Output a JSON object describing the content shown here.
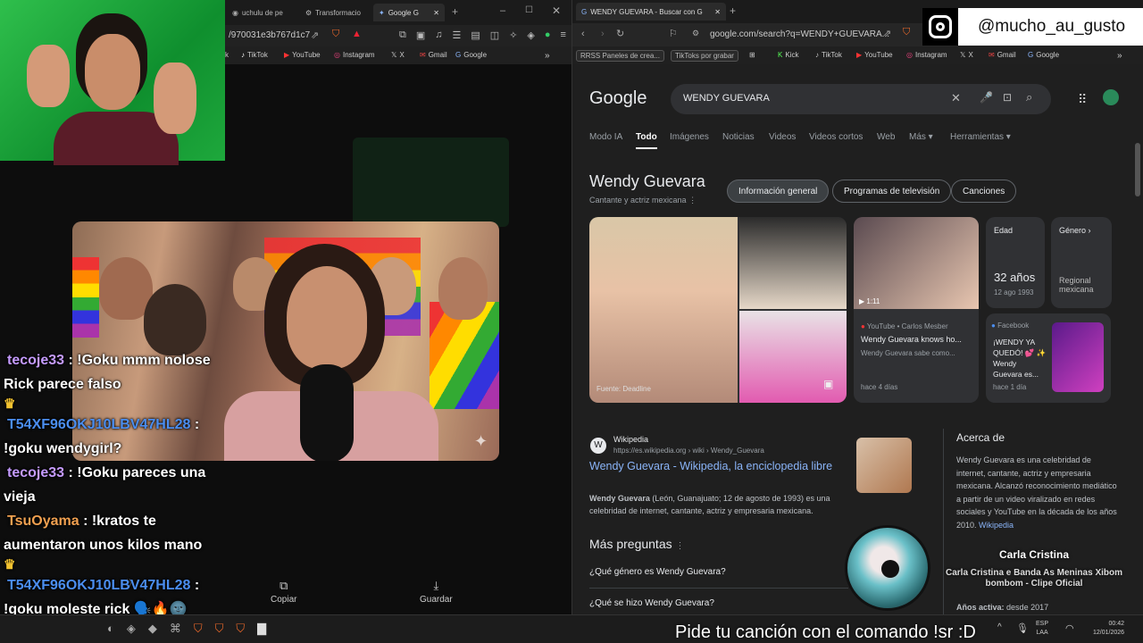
{
  "left_browser": {
    "tabs": [
      "uchulu de pe",
      "Transformacio",
      "Google G"
    ],
    "url_fragment": "/970031e3b767d1c7",
    "bookmarks": [
      "k",
      "TikTok",
      "YouTube",
      "Instagram",
      "X",
      "Gmail",
      "Google"
    ],
    "actions": {
      "copy": "Copiar",
      "save": "Guardar"
    }
  },
  "chat": {
    "messages": [
      {
        "user": "tecoje33",
        "user_color": "#c59bff",
        "text": "!Goku mmm nolose Rick parece falso",
        "badge": true
      },
      {
        "user": "T54XF96OKJ10LBV47HL28",
        "user_color": "#4b8ef0",
        "text": "!goku wendygirl?",
        "badge": false
      },
      {
        "user": "tecoje33",
        "user_color": "#c59bff",
        "text": "!Goku pareces una vieja",
        "badge": false
      },
      {
        "user": "TsuOyama",
        "user_color": "#f0a050",
        "text": "!kratos te aumentaron unos kilos mano",
        "badge": true
      },
      {
        "user": "T54XF96OKJ10LBV47HL28",
        "user_color": "#4b8ef0",
        "text": "!goku moleste rick 🗣️🔥🌚",
        "badge": false
      }
    ]
  },
  "right_browser": {
    "tab_title": "WENDY GUEVARA - Buscar con G",
    "url": "google.com/search?q=WENDY+GUEVARA...",
    "bookmarks": [
      "RRSS Paneles de crea...",
      "TikToks por grabar",
      "Kick",
      "TikTok",
      "YouTube",
      "Instagram",
      "X",
      "Gmail",
      "Google"
    ],
    "search": {
      "logo": "Google",
      "query": "WENDY GUEVARA",
      "tabs": [
        "Modo IA",
        "Todo",
        "Imágenes",
        "Noticias",
        "Videos",
        "Videos cortos",
        "Web",
        "Más",
        "Herramientas"
      ],
      "active_tab": "Todo"
    },
    "kp": {
      "title": "Wendy Guevara",
      "subtitle": "Cantante y actriz mexicana",
      "pills": [
        "Información general",
        "Programas de televisión",
        "Canciones"
      ],
      "age_label": "Edad",
      "age_value": "32 años",
      "age_date": "12 ago 1993",
      "genre_label": "Género",
      "genre_value": "Regional mexicana",
      "video_duration": "1:11",
      "video_source": "YouTube • Carlos Mesber",
      "video_title": "Wendy Guevara knows ho...",
      "video_desc": "Wendy Guevara sabe como...",
      "video_age": "hace 4 días",
      "fb_source": "Facebook",
      "fb_text": "¡WENDY YA QUEDÓ! 💕 ✨ Wendy Guevara es...",
      "fb_age": "hace 1 día",
      "img_source": "Fuente: Deadline"
    },
    "result": {
      "site": "Wikipedia",
      "url": "https://es.wikipedia.org › wiki › Wendy_Guevara",
      "title": "Wendy Guevara - Wikipedia, la enciclopedia libre",
      "snippet_bold": "Wendy Guevara",
      "snippet": " (León, Guanajuato; 12 de agosto de 1993) es una celebridad de internet, cantante, actriz y empresaria mexicana."
    },
    "about": {
      "title": "Acerca de",
      "text": "Wendy Guevara  es una celebridad de internet, cantante, actriz y empresaria mexicana. Alcanzó reconocimiento mediático a partir de un video viralizado en redes sociales y YouTube en la década de los años 2010.",
      "link": "Wikipedia",
      "active_label": "Años activa:",
      "active_value": "desde 2017"
    },
    "paa": {
      "title": "Más preguntas",
      "q1": "¿Qué género es Wendy Guevara?",
      "q2": "¿Qué se hizo Wendy Guevara?"
    }
  },
  "overlay": {
    "instagram_handle": "@mucho_au_gusto",
    "subtitle": "Pide tu canción con el comando !sr :D",
    "now_playing_artist": "Carla Cristina",
    "now_playing_song": "Carla Cristina e Banda As Meninas Xibom bombom - Clipe Oficial"
  },
  "taskbar": {
    "lang1": "ESP",
    "lang2": "LAA",
    "time": "00:42",
    "date": "12/01/2026"
  }
}
